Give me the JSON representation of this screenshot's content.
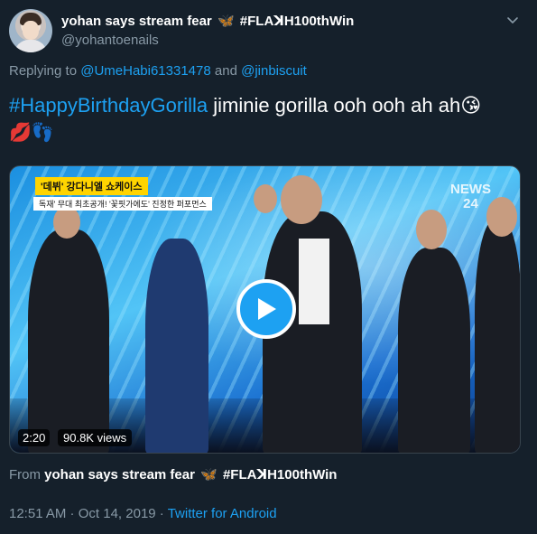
{
  "author": {
    "display_name_prefix": "yohan says stream fear",
    "display_name_emoji": "🦋",
    "display_name_suffix": "#FLAꓘH100thWin",
    "handle": "@yohantoenails"
  },
  "reply": {
    "prefix": "Replying to",
    "user1": "@UmeHabi61331478",
    "conjunction": "and",
    "user2": "@jinbiscuit"
  },
  "tweet": {
    "hashtag": "#HappyBirthdayGorilla",
    "text": " jiminie gorilla ooh ooh ah ah",
    "emoji_end": "😘",
    "emoji_line": "💋👣"
  },
  "video": {
    "duration": "2:20",
    "views": "90.8K views",
    "badge_text": "'데뷔' 강다니엘 쇼케이스",
    "subtitle_text": "독재' 무대 최초공개! '꽃핏가에도' 진정한 퍼포먼스",
    "logo_line1": "NEWS",
    "logo_line2": "24"
  },
  "from": {
    "prefix": "From",
    "name_prefix": "yohan says stream fear",
    "name_emoji": "🦋",
    "name_suffix": "#FLAꓘH100thWin"
  },
  "meta": {
    "time": "12:51 AM",
    "separator1": " · ",
    "date": "Oct 14, 2019",
    "separator2": " · ",
    "source": "Twitter for Android"
  },
  "colors": {
    "background": "#15202b",
    "accent": "#1da1f2",
    "secondary_text": "#8899a6"
  },
  "icons": {
    "caret": "chevron-down-icon",
    "play": "play-icon"
  }
}
